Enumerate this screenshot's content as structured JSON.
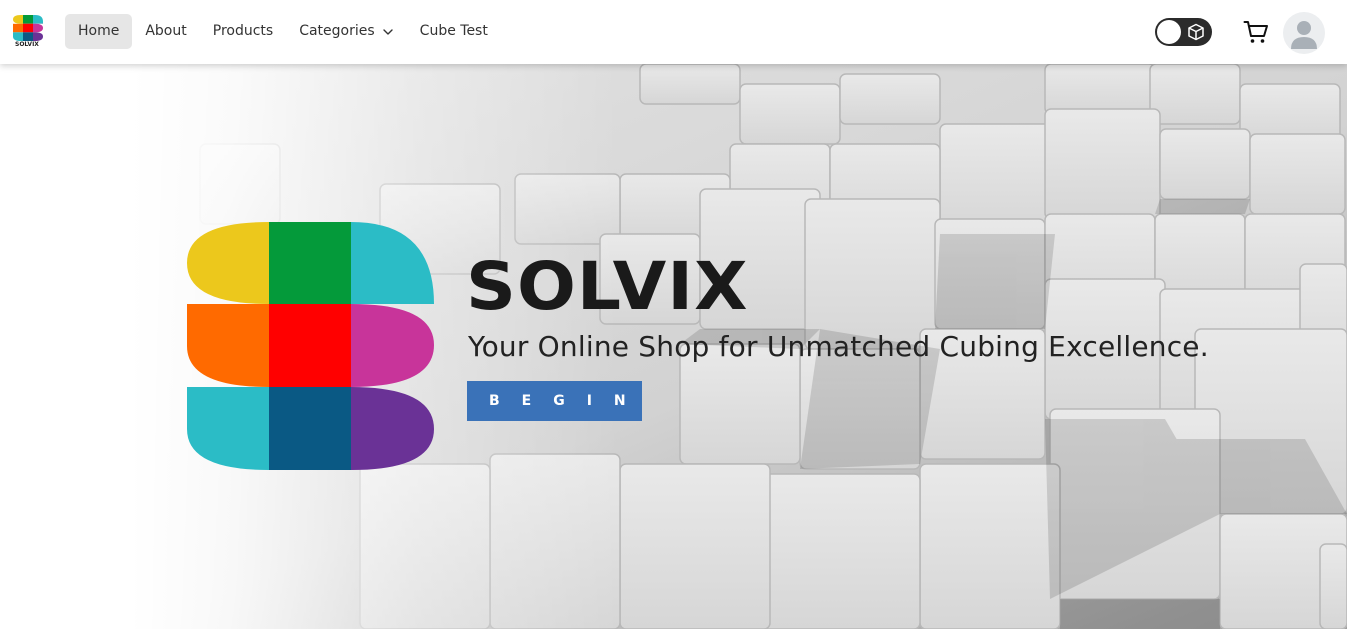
{
  "brand": {
    "name": "SOLVIX"
  },
  "nav": {
    "items": [
      {
        "label": "Home",
        "active": true
      },
      {
        "label": "About",
        "active": false
      },
      {
        "label": "Products",
        "active": false
      },
      {
        "label": "Categories",
        "active": false,
        "dropdown": true
      },
      {
        "label": "Cube Test",
        "active": false
      }
    ]
  },
  "header_actions": {
    "theme_toggle": {
      "icon": "cube-icon"
    },
    "cart": {
      "icon": "cart-icon"
    },
    "account": {
      "icon": "avatar-icon"
    }
  },
  "hero": {
    "title": "SOLVIX",
    "subtitle": "Your Online Shop for Unmatched Cubing Excellence.",
    "cta_label": "BEGIN"
  },
  "colors": {
    "cta_blue": "#3a72b8",
    "logo_yellow": "#ecc81c",
    "logo_green": "#049a3a",
    "logo_teal": "#2bbcc6",
    "logo_orange": "#ff6a00",
    "logo_red": "#ff0000",
    "logo_magenta": "#c8349a",
    "logo_navy": "#0a5984",
    "logo_purple": "#6a3296"
  }
}
